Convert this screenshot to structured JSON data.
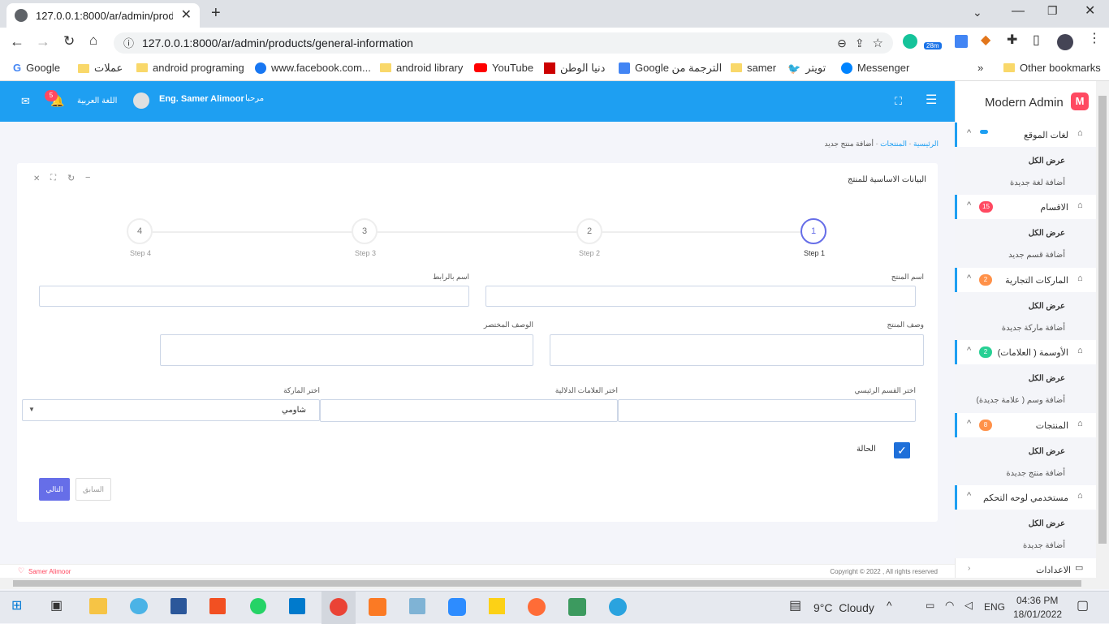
{
  "browser": {
    "tab_title": "127.0.0.1:8000/ar/admin/products/general-information",
    "url": "127.0.0.1:8000/ar/admin/products/general-information",
    "bookmarks": [
      "Google",
      "عملات",
      "android programing",
      "www.facebook.com...",
      "android library",
      "YouTube",
      "دنيا الوطن",
      "Google الترجمة من",
      "samer",
      "تويتر",
      "Messenger"
    ],
    "other_bookmarks": "Other bookmarks",
    "weather_badge": "28m"
  },
  "navbar": {
    "greeting": "مرحبا",
    "user_name": "Eng. Samer Alimoor",
    "language": "اللغة العربية",
    "notif_count": "5"
  },
  "sidebar": {
    "brand": "Modern Admin",
    "brand_letter": "M",
    "groups": [
      {
        "title": "لغات الموقع",
        "badge": "",
        "items": [
          "عرض الكل",
          "أضافة لغة جديدة"
        ]
      },
      {
        "title": "الاقسام",
        "badge": "15",
        "items": [
          "عرض الكل",
          "أضافة قسم جديد"
        ]
      },
      {
        "title": "الماركات التجارية",
        "badge": "2",
        "items": [
          "عرض الكل",
          "أضافة ماركة جديدة"
        ]
      },
      {
        "title": "الأوسمة ( العلامات)",
        "badge": "2",
        "items": [
          "عرض الكل",
          "أضافة وسم ( علامة جديدة)"
        ]
      },
      {
        "title": "المنتجات",
        "badge": "8",
        "items": [
          "عرض الكل",
          "أضافة منتج جديدة"
        ]
      },
      {
        "title": "مستخدمي لوحه التحكم",
        "badge": "",
        "items": [
          "عرض الكل",
          "أضافة جديدة"
        ]
      }
    ],
    "settings": "الاعدادات",
    "badge_colors": [
      "#1e9ff2",
      "#ff4961",
      "#ff9149",
      "#28d094",
      "#ff9149",
      ""
    ]
  },
  "breadcrumb": {
    "home": "الرئيسية",
    "products": "المنتجات",
    "current": "أضافة منتج جديد"
  },
  "card": {
    "title": "البيانات الاساسية للمنتج",
    "steps": [
      {
        "num": "1",
        "label": "Step 1"
      },
      {
        "num": "2",
        "label": "Step 2"
      },
      {
        "num": "3",
        "label": "Step 3"
      },
      {
        "num": "4",
        "label": "Step 4"
      }
    ],
    "labels": {
      "product_name": "اسم المنتج",
      "slug": "اسم بالرابط",
      "description": "وصف المنتج",
      "short_description": "الوصف المختصر",
      "main_category": "اختر القسم الرئيسي",
      "tags": "اختر العلامات الدلالية",
      "brand": "اختر الماركة",
      "status": "الحالة"
    },
    "brand_selected": "شاومي",
    "buttons": {
      "next": "التالي",
      "prev": "السابق"
    }
  },
  "footer": {
    "author": "Samer Alimoor",
    "copyright": "Copyright © 2022 , All rights reserved"
  },
  "taskbar": {
    "weather": "9°C  Cloudy",
    "lang": "ENG",
    "time": "04:36 PM",
    "date": "18/01/2022"
  }
}
